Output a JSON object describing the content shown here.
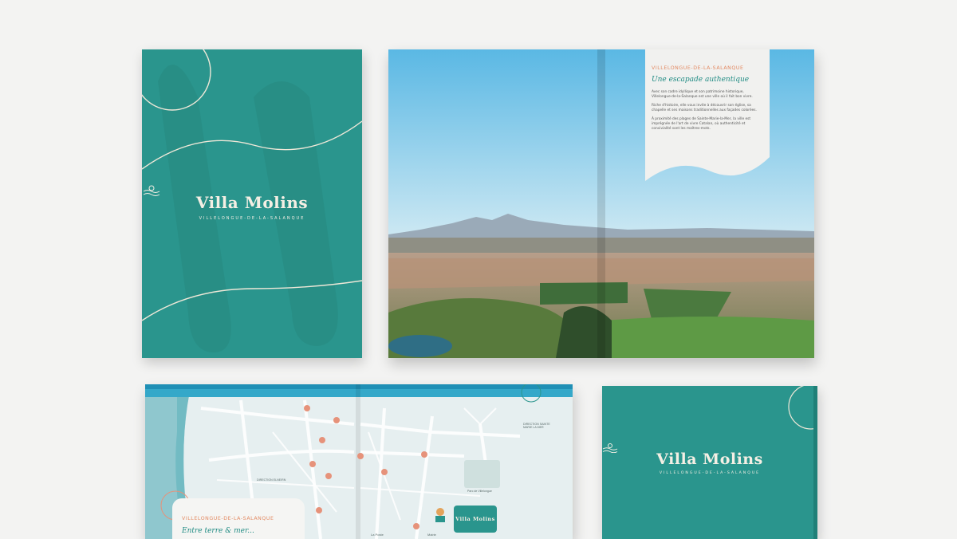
{
  "brand": {
    "name": "Villa Molins",
    "location": "VILLELONGUE-DE-LA-SALANQUE"
  },
  "spread": {
    "kicker": "VILLELONGUE-DE-LA-SALANQUE",
    "headline": "Une escapade authentique",
    "paragraphs": [
      "Avec son cadre idyllique et son patrimoine historique, Villelongue-de-la-Salanque est une ville où il fait bon vivre.",
      "Riche d'histoire, elle vous invite à découvrir son église, sa chapelle et ses maisons traditionnelles aux façades colorées.",
      "À proximité des plages de Sainte-Marie-la-Mer, la ville est imprégnée de l'art de vivre Catalan, où authenticité et convivialité sont les maîtres-mots."
    ]
  },
  "map_spread": {
    "kicker": "VILLELONGUE-DE-LA-SALANQUE",
    "headline": "Entre terre & mer...",
    "direction_east": "DIRECTION SAINTE MARIE LA MER",
    "direction_west": "DIRECTION ELNE/RN",
    "labels": [
      "La Poste",
      "Mairie",
      "Parc de Villelongue"
    ],
    "logo_name": "Villa Molins"
  },
  "colors": {
    "teal": "#2a958d",
    "cream": "#f4efe4",
    "coral": "#e38a63"
  }
}
